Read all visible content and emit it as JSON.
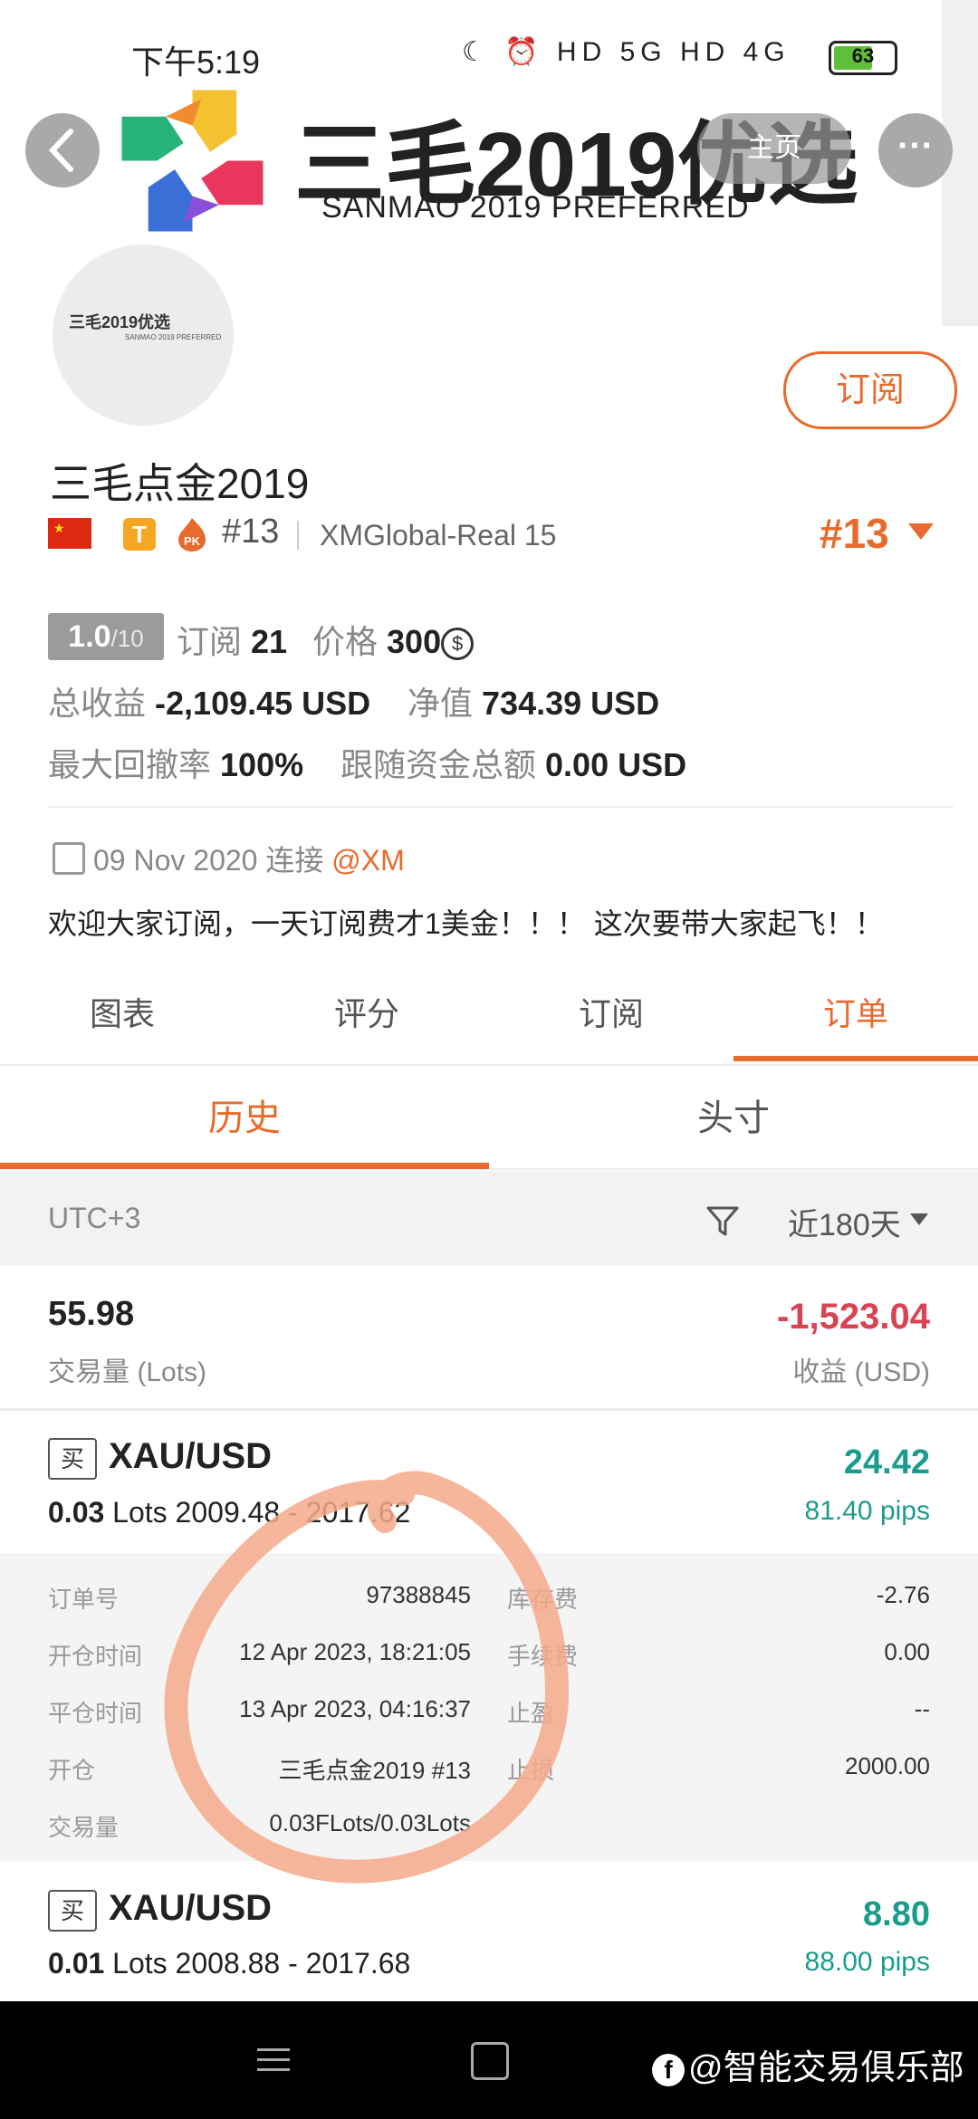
{
  "status_bar": {
    "time": "下午5:19",
    "icons_text": "☾ ⏰ HD 5G HD 4G",
    "battery": "63"
  },
  "header": {
    "home_label": "主页",
    "more_label": "···",
    "logo_title": "三毛2019优选",
    "logo_subtitle": "SANMAO 2019 PREFERRED",
    "avatar_text": "三毛2019优选",
    "avatar_subtext": "SANMAO 2019 PREFERRED",
    "subscribe_label": "订阅"
  },
  "profile": {
    "name": "三毛点金2019",
    "tier_badge": "T",
    "pk_badge": "PK",
    "rank_small": "#13",
    "server": "XMGlobal-Real 15",
    "rank_large": "#13",
    "score": "1.0",
    "score_max": "/10",
    "subscribers_label": "订阅",
    "subscribers": "21",
    "price_label": "价格",
    "price": "300",
    "price_coin": "$",
    "total_profit_label": "总收益",
    "total_profit": "-2,109.45",
    "total_profit_unit": "USD",
    "equity_label": "净值",
    "equity": "734.39",
    "equity_unit": "USD",
    "max_drawdown_label": "最大回撤率",
    "max_drawdown": "100%",
    "follow_funds_label": "跟随资金总额",
    "follow_funds": "0.00",
    "follow_funds_unit": "USD",
    "connected_date": "09 Nov 2020",
    "connected_label": "连接",
    "broker": "@XM",
    "welcome": "欢迎大家订阅，一天订阅费才1美金！！！ 这次要带大家起飞！！"
  },
  "tabs": [
    "图表",
    "评分",
    "订阅",
    "订单"
  ],
  "active_tab": "订单",
  "subtabs": [
    "历史",
    "头寸"
  ],
  "active_subtab": "历史",
  "filter": {
    "timezone": "UTC+3",
    "range": "近180天"
  },
  "summary": {
    "lots": "55.98",
    "lots_label": "交易量 (Lots)",
    "profit": "-1,523.04",
    "profit_label": "收益 (USD)"
  },
  "orders": [
    {
      "side": "买",
      "symbol": "XAU/USD",
      "lots": "0.03",
      "lots_unit": "Lots",
      "prices": "2009.48 - 2017.62",
      "profit": "24.42",
      "pips": "81.40 pips",
      "details": {
        "order_no_label": "订单号",
        "order_no": "97388845",
        "open_time_label": "开仓时间",
        "open_time": "12 Apr 2023, 18:21:05",
        "close_time_label": "平仓时间",
        "close_time": "13 Apr 2023, 04:16:37",
        "open_label": "开仓",
        "open": "三毛点金2019  #13",
        "volume_label": "交易量",
        "volume": "0.03FLots/0.03Lots",
        "swap_label": "库存费",
        "swap": "-2.76",
        "fee_label": "手续费",
        "fee": "0.00",
        "tp_label": "止盈",
        "tp": "--",
        "sl_label": "止损",
        "sl": "2000.00"
      }
    },
    {
      "side": "买",
      "symbol": "XAU/USD",
      "lots": "0.01",
      "lots_unit": "Lots",
      "prices": "2008.88 - 2017.68",
      "profit": "8.80",
      "pips": "88.00 pips"
    }
  ],
  "watermark": "@智能交易俱乐部",
  "watermark_icon": "f",
  "colors": {
    "accent": "#e86a2c",
    "loss": "#d94452",
    "gain": "#1a9c8c",
    "annotation_circle": "#f4a98a"
  }
}
